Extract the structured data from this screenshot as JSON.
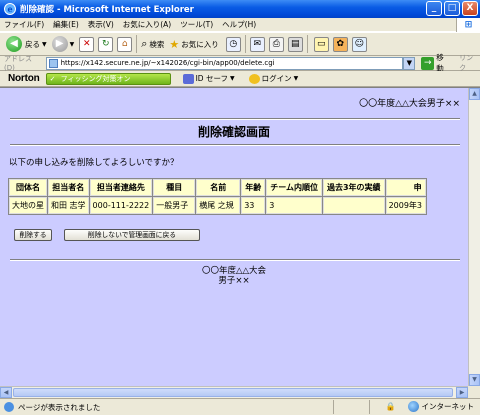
{
  "window": {
    "title": "削除確認 - Microsoft Internet Explorer",
    "buttons": {
      "minimize": "_",
      "maximize": "□",
      "close": "X"
    }
  },
  "menu": [
    "ファイル(F)",
    "編集(E)",
    "表示(V)",
    "お気に入り(A)",
    "ツール(T)",
    "ヘルプ(H)"
  ],
  "toolbar": {
    "back": "戻る",
    "search": "検索",
    "favorites": "お気に入り"
  },
  "address": {
    "label": "アドレス(D)",
    "url": "https://x142.secure.ne.jp/~x142026/cgi-bin/app00/delete.cgi",
    "go": "移動",
    "links": "リンク"
  },
  "norton": {
    "brand": "Norton",
    "phishing": "フィッシング対策オン",
    "id_safe": "ID セーフ",
    "login": "ログイン"
  },
  "page": {
    "event_title": "〇〇年度△△大会男子××",
    "heading": "削除確認画面",
    "prompt": "以下の申し込みを削除してよろしいですか？",
    "table": {
      "headers": [
        "団体名",
        "担当者名",
        "担当者連絡先",
        "種目",
        "名前",
        "年齢",
        "チーム内順位",
        "過去3年の実績",
        "申"
      ],
      "row": [
        "大地の星",
        "和田 志学",
        "000-111-2222",
        "一般男子",
        "横尾 之規",
        "33",
        "3",
        "",
        "2009年3"
      ]
    },
    "delete_button": "削除する",
    "back_button": "削除しないで管理画面に戻る",
    "footer_line1": "〇〇年度△△大会",
    "footer_line2": "男子××"
  },
  "status": {
    "text": "ページが表示されました",
    "zone": "インターネット"
  }
}
